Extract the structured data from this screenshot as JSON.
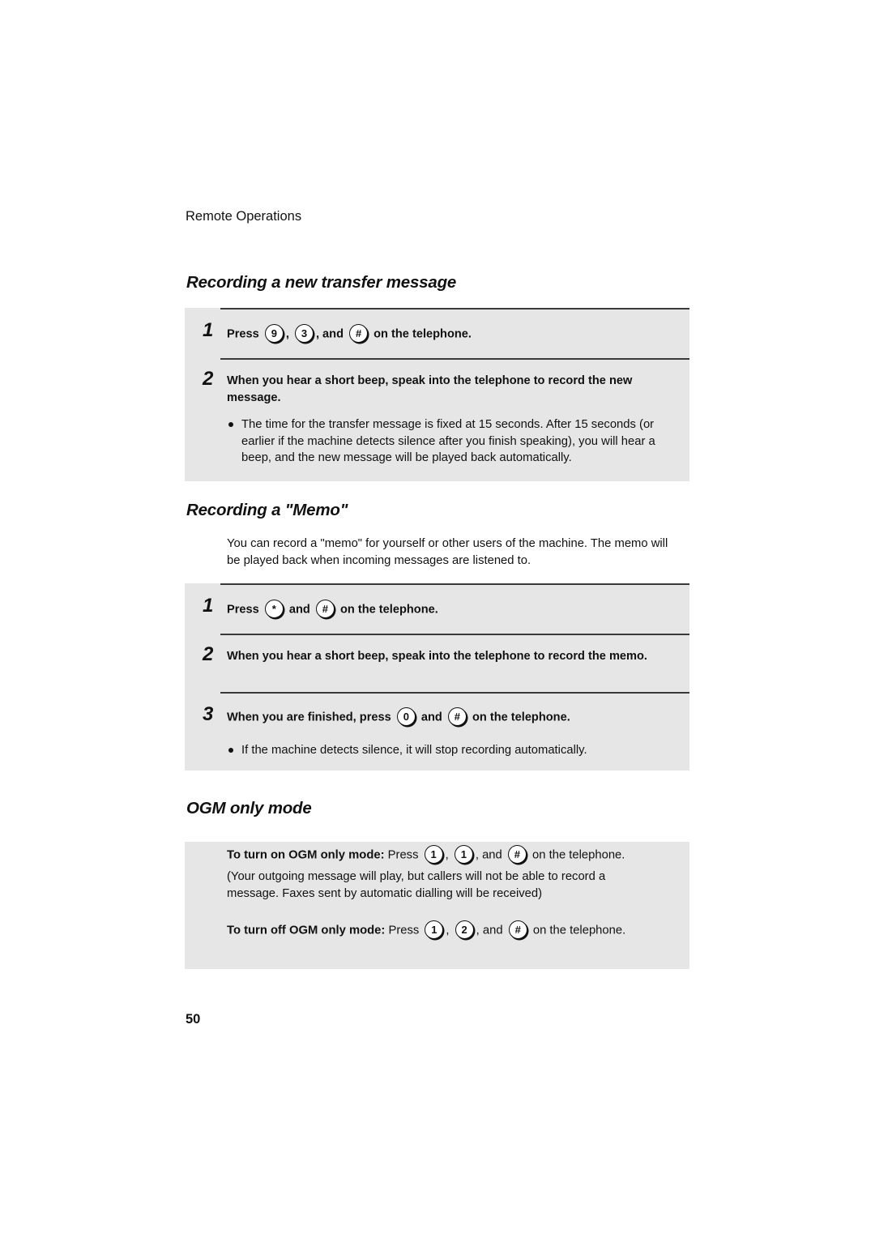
{
  "running_head": "Remote Operations",
  "page_number": "50",
  "sections": {
    "transfer": {
      "title": "Recording a new transfer message",
      "steps": [
        {
          "number": "1",
          "parts": {
            "press": "Press",
            "sep1": ",",
            "sep2": ", and",
            "end": "on the telephone."
          },
          "keys": [
            "9",
            "3",
            "#"
          ]
        },
        {
          "number": "2",
          "text": "When you hear a short beep, speak into the telephone to record the new message.",
          "bullet": "The time for the transfer message is fixed at 15 seconds. After 15 seconds (or earlier if the machine detects silence after you finish speaking), you will hear a beep, and the new message will be played back automatically."
        }
      ]
    },
    "memo": {
      "title": "Recording a \"Memo\"",
      "intro": "You can record a \"memo\" for yourself or other users of the machine. The memo will be played back when incoming messages are listened to.",
      "steps": [
        {
          "number": "1",
          "parts": {
            "press": "Press",
            "and": "and",
            "end": "on the telephone."
          },
          "keys": [
            "*",
            "#"
          ]
        },
        {
          "number": "2",
          "text": "When you hear a short beep, speak into the telephone to record the memo."
        },
        {
          "number": "3",
          "parts": {
            "press": "When you are finished, press",
            "and": "and",
            "end": "on the telephone."
          },
          "keys": [
            "0",
            "#"
          ],
          "bullet": "If the machine detects silence, it will stop recording automatically."
        }
      ]
    },
    "ogm": {
      "title": "OGM only mode",
      "turn_on": {
        "label": "To turn on OGM only mode:",
        "press": "Press",
        "sep1": ",",
        "sep2": ", and",
        "end": "on the telephone.",
        "keys": [
          "1",
          "1",
          "#"
        ],
        "note": "(Your outgoing message will play, but callers will not be able to record a message. Faxes sent by automatic dialling will be received)"
      },
      "turn_off": {
        "label": "To turn off OGM only mode:",
        "press": "Press",
        "sep1": ",",
        "sep2": ", and",
        "end": "on the telephone.",
        "keys": [
          "1",
          "2",
          "#"
        ]
      }
    }
  }
}
